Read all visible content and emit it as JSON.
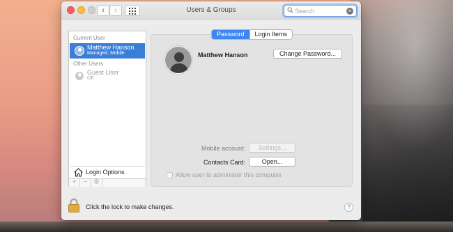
{
  "window": {
    "title": "Users & Groups"
  },
  "toolbar": {
    "back_glyph": "‹",
    "forward_glyph": "›",
    "grid_icon": "grid-icon"
  },
  "search": {
    "placeholder": "Search",
    "value": "",
    "clear_glyph": "×"
  },
  "sidebar": {
    "current_user_heading": "Current User",
    "current_user": {
      "name": "Matthew Hanson",
      "subtitle": "Managed, Mobile"
    },
    "other_users_heading": "Other Users",
    "other_users": [
      {
        "name": "Guest User",
        "subtitle": "Off"
      }
    ],
    "login_options_label": "Login Options",
    "add_glyph": "+",
    "remove_glyph": "−",
    "action_glyph": "⚙"
  },
  "tabs": [
    {
      "label": "Password",
      "active": true
    },
    {
      "label": "Login Items",
      "active": false
    }
  ],
  "main": {
    "username": "Matthew Hanson",
    "change_password_label": "Change Password...",
    "mobile_account_label": "Mobile account:",
    "settings_label": "Settings...",
    "contacts_card_label": "Contacts Card:",
    "open_label": "Open...",
    "allow_admin_label": "Allow user to administer this computer"
  },
  "footer": {
    "lock_text": "Click the lock to make changes.",
    "help_glyph": "?"
  },
  "colors": {
    "accent": "#3b87f4",
    "selection": "#3a7fd6",
    "lock": "#d9a441"
  }
}
